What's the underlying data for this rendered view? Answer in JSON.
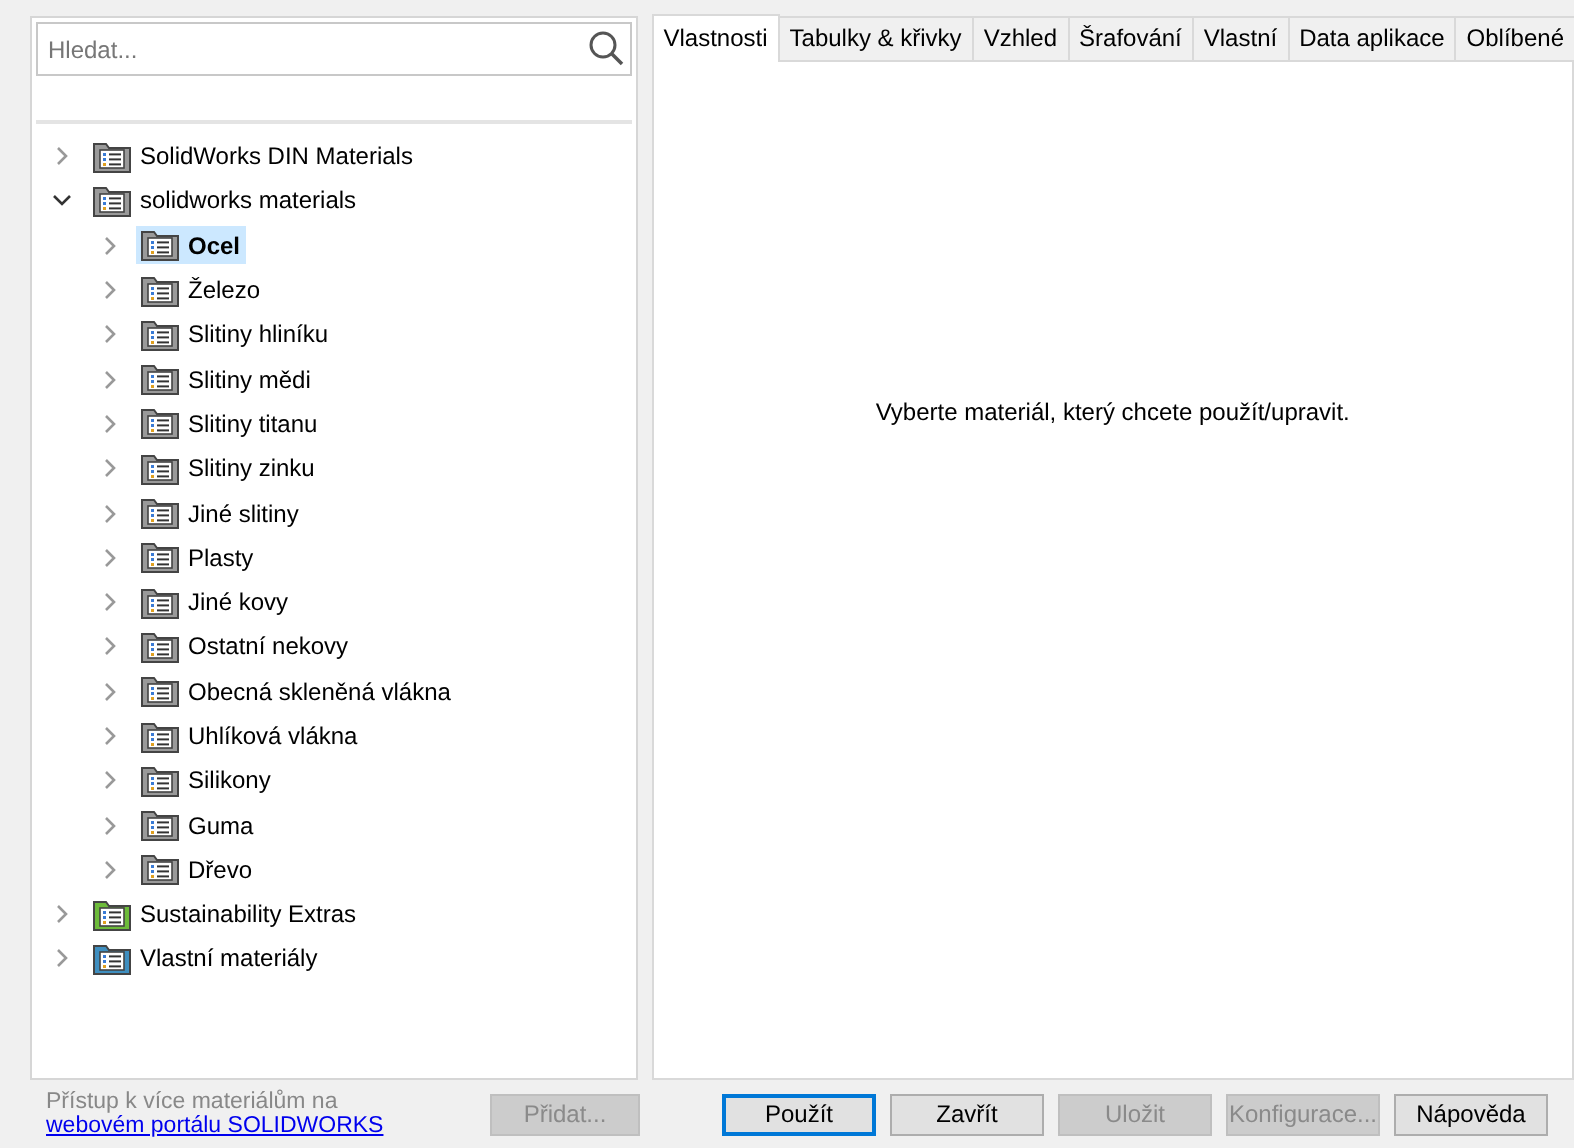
{
  "search": {
    "placeholder": "Hledat..."
  },
  "tree": [
    {
      "label": "SolidWorks DIN Materials",
      "color": "#9a9a9a",
      "expanded": false,
      "selected": false
    },
    {
      "label": "solidworks materials",
      "color": "#9a9a9a",
      "expanded": true,
      "selected": false,
      "children": [
        {
          "label": "Ocel",
          "color": "#9a9a9a",
          "expanded": false,
          "selected": true
        },
        {
          "label": "Železo",
          "color": "#9a9a9a",
          "expanded": false,
          "selected": false
        },
        {
          "label": "Slitiny hliníku",
          "color": "#9a9a9a",
          "expanded": false,
          "selected": false
        },
        {
          "label": "Slitiny mědi",
          "color": "#9a9a9a",
          "expanded": false,
          "selected": false
        },
        {
          "label": "Slitiny titanu",
          "color": "#9a9a9a",
          "expanded": false,
          "selected": false
        },
        {
          "label": "Slitiny zinku",
          "color": "#9a9a9a",
          "expanded": false,
          "selected": false
        },
        {
          "label": "Jiné slitiny",
          "color": "#9a9a9a",
          "expanded": false,
          "selected": false
        },
        {
          "label": "Plasty",
          "color": "#9a9a9a",
          "expanded": false,
          "selected": false
        },
        {
          "label": "Jiné kovy",
          "color": "#9a9a9a",
          "expanded": false,
          "selected": false
        },
        {
          "label": "Ostatní nekovy",
          "color": "#9a9a9a",
          "expanded": false,
          "selected": false
        },
        {
          "label": "Obecná skleněná vlákna",
          "color": "#9a9a9a",
          "expanded": false,
          "selected": false
        },
        {
          "label": "Uhlíková vlákna",
          "color": "#9a9a9a",
          "expanded": false,
          "selected": false
        },
        {
          "label": "Silikony",
          "color": "#9a9a9a",
          "expanded": false,
          "selected": false
        },
        {
          "label": "Guma",
          "color": "#9a9a9a",
          "expanded": false,
          "selected": false
        },
        {
          "label": "Dřevo",
          "color": "#9a9a9a",
          "expanded": false,
          "selected": false
        }
      ]
    },
    {
      "label": "Sustainability Extras",
      "color": "#6dbb3a",
      "expanded": false,
      "selected": false
    },
    {
      "label": "Vlastní materiály",
      "color": "#3f8fc0",
      "expanded": false,
      "selected": false
    }
  ],
  "tabs": [
    {
      "label": "Vlastnosti",
      "selected": true
    },
    {
      "label": "Tabulky & křivky",
      "selected": false
    },
    {
      "label": "Vzhled",
      "selected": false
    },
    {
      "label": "Šrafování",
      "selected": false
    },
    {
      "label": "Vlastní",
      "selected": false
    },
    {
      "label": "Data aplikace",
      "selected": false
    },
    {
      "label": "Oblíbené",
      "selected": false
    }
  ],
  "message": "Vyberte materiál, který chcete použít/upravit.",
  "footer": {
    "note": "Přístup k více materiálům na",
    "link": "webovém portálu SOLIDWORKS",
    "add_button": {
      "label": "Přidat...",
      "disabled": true
    }
  },
  "buttons": [
    {
      "label": "Použít",
      "disabled": false,
      "default": true
    },
    {
      "label": "Zavřít",
      "disabled": false,
      "default": false
    },
    {
      "label": "Uložit",
      "disabled": true,
      "default": false
    },
    {
      "label": "Konfigurace...",
      "disabled": true,
      "default": false
    },
    {
      "label": "Nápověda",
      "disabled": false,
      "default": false
    }
  ]
}
